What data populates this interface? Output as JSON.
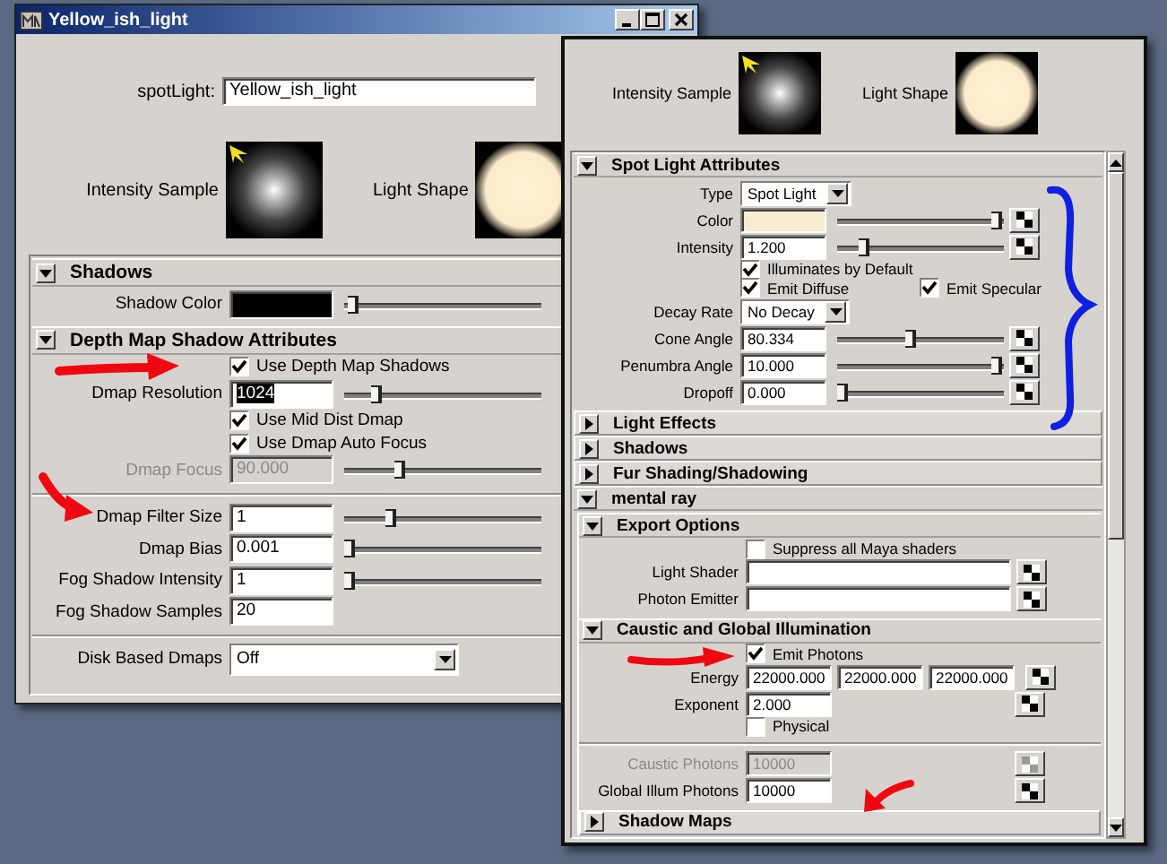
{
  "left_window": {
    "title": "Yellow_ish_light",
    "node_label": "spotLight:",
    "node_name": "Yellow_ish_light",
    "previews": [
      "Intensity Sample",
      "Light Shape"
    ],
    "sections": [
      {
        "kind": "section",
        "title": "Shadows",
        "expanded": true,
        "children": [
          {
            "kind": "color",
            "label": "Shadow Color",
            "color": "#000000",
            "level": 0.02
          }
        ]
      },
      {
        "kind": "section",
        "title": "Depth Map Shadow Attributes",
        "expanded": true,
        "children": [
          {
            "kind": "checkbox",
            "label": "Use Depth Map Shadows",
            "checked": true
          },
          {
            "kind": "field",
            "label": "Dmap Resolution",
            "value": "1024",
            "highlighted": true,
            "level": 0.15
          },
          {
            "kind": "checkbox",
            "label": "Use Mid Dist Dmap",
            "checked": true
          },
          {
            "kind": "checkbox",
            "label": "Use Dmap Auto Focus",
            "checked": true
          },
          {
            "kind": "field",
            "label": "Dmap Focus",
            "value": "90.000",
            "disabled": true,
            "level": 0.27
          },
          {
            "kind": "separator"
          },
          {
            "kind": "field",
            "label": "Dmap Filter Size",
            "value": "1",
            "level": 0.22
          },
          {
            "kind": "field",
            "label": "Dmap Bias",
            "value": "0.001",
            "level": 0.0
          },
          {
            "kind": "field",
            "label": "Fog Shadow Intensity",
            "value": "1",
            "level": 0.0
          },
          {
            "kind": "field",
            "label": "Fog Shadow Samples",
            "value": "20"
          },
          {
            "kind": "separator"
          },
          {
            "kind": "dropdown",
            "label": "Disk Based Dmaps",
            "value": "Off"
          }
        ]
      }
    ]
  },
  "right_window": {
    "previews": [
      "Intensity Sample",
      "Light Shape"
    ],
    "sections": [
      {
        "kind": "section",
        "title": "Spot Light Attributes",
        "expanded": true,
        "children": [
          {
            "kind": "dropdown",
            "label": "Type",
            "value": "Spot Light"
          },
          {
            "kind": "color",
            "label": "Color",
            "color": "#f8ecd0",
            "level": 1.0,
            "map_button": true
          },
          {
            "kind": "field",
            "label": "Intensity",
            "value": "1.200",
            "level": 0.14,
            "map_button": true
          },
          {
            "kind": "checkbox",
            "label": "Illuminates by Default",
            "checked": true
          },
          {
            "kind": "checkbox_pair",
            "items": [
              {
                "label": "Emit Diffuse",
                "checked": true
              },
              {
                "label": "Emit Specular",
                "checked": true
              }
            ]
          },
          {
            "kind": "dropdown",
            "label": "Decay Rate",
            "value": "No Decay"
          },
          {
            "kind": "field",
            "label": "Cone Angle",
            "value": "80.334",
            "level": 0.44,
            "map_button": true
          },
          {
            "kind": "field",
            "label": "Penumbra Angle",
            "value": "10.000",
            "level": 1.0,
            "map_button": true
          },
          {
            "kind": "field",
            "label": "Dropoff",
            "value": "0.000",
            "level": 0.0,
            "map_button": true
          }
        ]
      },
      {
        "kind": "section",
        "title": "Light Effects",
        "expanded": false
      },
      {
        "kind": "section",
        "title": "Shadows",
        "expanded": false
      },
      {
        "kind": "section",
        "title": "Fur Shading/Shadowing",
        "expanded": false
      },
      {
        "kind": "section",
        "title": "mental ray",
        "expanded": true,
        "children": [
          {
            "kind": "section",
            "title": "Export Options",
            "expanded": true,
            "children": [
              {
                "kind": "checkbox",
                "label": "Suppress all Maya shaders",
                "checked": false
              },
              {
                "kind": "wide_field",
                "label": "Light Shader",
                "map_button": true
              },
              {
                "kind": "wide_field",
                "label": "Photon Emitter",
                "map_button": true
              }
            ]
          },
          {
            "kind": "section",
            "title": "Caustic and Global Illumination",
            "expanded": true,
            "children": [
              {
                "kind": "checkbox",
                "label": "Emit Photons",
                "checked": true
              },
              {
                "kind": "triple",
                "label": "Energy",
                "values": [
                  "22000.000",
                  "22000.000",
                  "22000.000"
                ],
                "map_button": true
              },
              {
                "kind": "field",
                "label": "Exponent",
                "value": "2.000",
                "map_button": true
              },
              {
                "kind": "checkbox",
                "label": "Physical",
                "checked": false
              },
              {
                "kind": "separator"
              },
              {
                "kind": "field",
                "label": "Caustic Photons",
                "value": "10000",
                "disabled": true,
                "map_button": true
              },
              {
                "kind": "field",
                "label": "Global Illum Photons",
                "value": "10000",
                "map_button": true
              }
            ]
          },
          {
            "kind": "section",
            "title": "Shadow Maps",
            "expanded": false
          }
        ]
      }
    ]
  }
}
